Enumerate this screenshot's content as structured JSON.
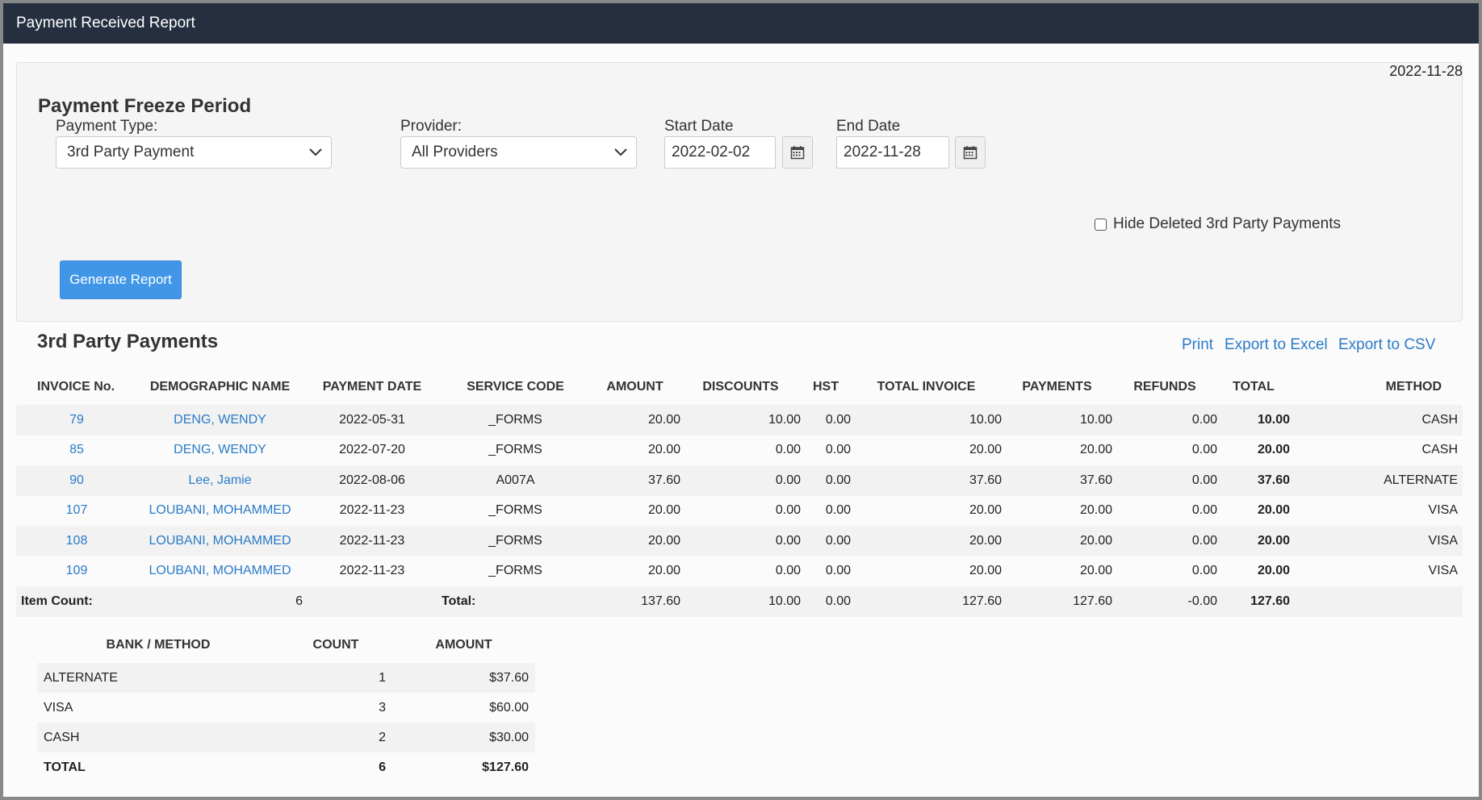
{
  "window": {
    "title": "Payment Received Report"
  },
  "report_date": "2022-11-28",
  "filters": {
    "heading": "Payment Freeze Period",
    "payment_type_label": "Payment Type:",
    "payment_type_value": "3rd Party Payment",
    "provider_label": "Provider:",
    "provider_value": "All Providers",
    "start_date_label": "Start Date",
    "start_date_value": "2022-02-02",
    "end_date_label": "End Date",
    "end_date_value": "2022-11-28",
    "hide_deleted_label": "Hide Deleted 3rd Party Payments",
    "hide_deleted_checked": false,
    "generate_label": "Generate Report"
  },
  "results": {
    "heading": "3rd Party Payments",
    "actions": {
      "print": "Print",
      "export_excel": "Export to Excel",
      "export_csv": "Export to CSV"
    },
    "columns": [
      "INVOICE No.",
      "DEMOGRAPHIC NAME",
      "PAYMENT DATE",
      "SERVICE CODE",
      "AMOUNT",
      "DISCOUNTS",
      "HST",
      "TOTAL INVOICE",
      "PAYMENTS",
      "REFUNDS",
      "TOTAL",
      "METHOD"
    ],
    "rows": [
      [
        "79",
        "DENG, WENDY",
        "2022-05-31",
        "_FORMS",
        "20.00",
        "10.00",
        "0.00",
        "10.00",
        "10.00",
        "0.00",
        "10.00",
        "CASH"
      ],
      [
        "85",
        "DENG, WENDY",
        "2022-07-20",
        "_FORMS",
        "20.00",
        "0.00",
        "0.00",
        "20.00",
        "20.00",
        "0.00",
        "20.00",
        "CASH"
      ],
      [
        "90",
        "Lee, Jamie",
        "2022-08-06",
        "A007A",
        "37.60",
        "0.00",
        "0.00",
        "37.60",
        "37.60",
        "0.00",
        "37.60",
        "ALTERNATE"
      ],
      [
        "107",
        "LOUBANI, MOHAMMED",
        "2022-11-23",
        "_FORMS",
        "20.00",
        "0.00",
        "0.00",
        "20.00",
        "20.00",
        "0.00",
        "20.00",
        "VISA"
      ],
      [
        "108",
        "LOUBANI, MOHAMMED",
        "2022-11-23",
        "_FORMS",
        "20.00",
        "0.00",
        "0.00",
        "20.00",
        "20.00",
        "0.00",
        "20.00",
        "VISA"
      ],
      [
        "109",
        "LOUBANI, MOHAMMED",
        "2022-11-23",
        "_FORMS",
        "20.00",
        "0.00",
        "0.00",
        "20.00",
        "20.00",
        "0.00",
        "20.00",
        "VISA"
      ]
    ],
    "footer": {
      "item_count_label": "Item Count:",
      "item_count": "6",
      "total_label": "Total:",
      "amount": "137.60",
      "discounts": "10.00",
      "hst": "0.00",
      "total_invoice": "127.60",
      "payments": "127.60",
      "refunds": "-0.00",
      "total": "127.60"
    }
  },
  "summary": {
    "columns": [
      "BANK / METHOD",
      "COUNT",
      "AMOUNT"
    ],
    "rows": [
      [
        "ALTERNATE",
        "1",
        "$37.60"
      ],
      [
        "VISA",
        "3",
        "$60.00"
      ],
      [
        "CASH",
        "2",
        "$30.00"
      ]
    ],
    "total": [
      "TOTAL",
      "6",
      "$127.60"
    ]
  },
  "colors": {
    "header_bg": "#252f40",
    "link": "#2a7bc8",
    "primary_button": "#4196e8"
  },
  "icons": {
    "dropdown": "chevron-down-icon",
    "calendar": "calendar-icon"
  }
}
